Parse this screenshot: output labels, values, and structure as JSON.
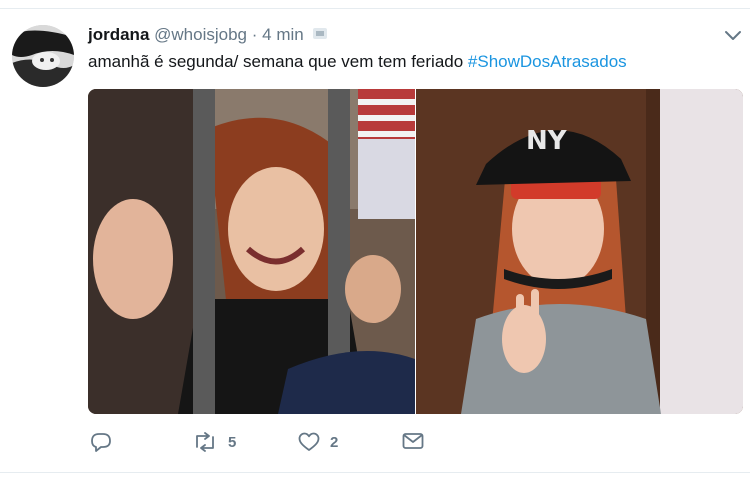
{
  "tweet": {
    "display_name": "jordana",
    "handle": "@whoisjobg",
    "separator": "·",
    "time": "4 min",
    "text": "amanhã é segunda/ semana que vem tem feriado ",
    "hashtag": "#ShowDosAtrasados"
  },
  "actions": {
    "retweet_count": "5",
    "like_count": "2"
  },
  "icons": {
    "reply": "reply-icon",
    "retweet": "retweet-icon",
    "like": "heart-icon",
    "message": "envelope-icon",
    "caret": "chevron-down-icon",
    "badge": "device-badge-icon"
  },
  "colors": {
    "hashtag": "#1b95e0",
    "muted": "#657786",
    "text": "#14171a",
    "divider": "#e6ecf0"
  }
}
